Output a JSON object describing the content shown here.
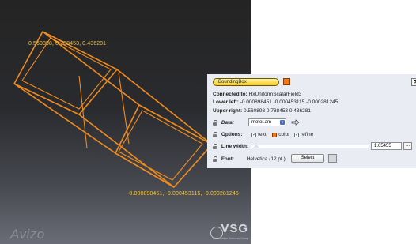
{
  "viewer": {
    "top_label": "0.560898, 0.788453, 0.436281",
    "bottom_label": "-0.000898451, -0.000453115, -0.000281245",
    "logo": "Avizo",
    "vsg_name": "VSG",
    "vsg_tagline": "Visualization Sciences Group"
  },
  "panel": {
    "module_name": "BoundingBox",
    "help_label": "?",
    "connected_label": "Connected to:",
    "connected_value": "HxUniformScalarField3",
    "lower_left_label": "Lower left:",
    "lower_left_value": "-0.000898451 -0.000453115 -0.000281245",
    "upper_right_label": "Upper right:",
    "upper_right_value": "0.560898 0.788453 0.436281",
    "data_label": "Data:",
    "data_value": "motor.am",
    "options_label": "Options:",
    "options": [
      {
        "label": "text",
        "checked": true
      },
      {
        "label": "color",
        "checked": true
      },
      {
        "label": "refine",
        "checked": true
      }
    ],
    "line_width_label": "Line width:",
    "line_width_value": "1.65455",
    "more_label": "...",
    "font_label": "Font:",
    "font_value": "Helvetica (12 pt.)",
    "select_label": "Select"
  },
  "colors": {
    "box_stroke": "#f08c1e",
    "label_color": "#f0c24a",
    "module_color": "#ee7a1a"
  }
}
